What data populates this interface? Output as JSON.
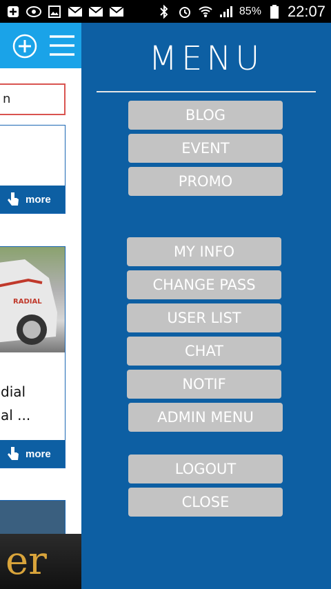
{
  "status_bar": {
    "battery_percent": "85%",
    "time": "22:07"
  },
  "background_app": {
    "search_text": "n",
    "card_more_label": "more",
    "card2_title": "dial",
    "card2_subtitle": "al ...",
    "bottom_text": "er"
  },
  "menu": {
    "title": "MENU",
    "items": [
      {
        "label": "BLOG"
      },
      {
        "label": "EVENT"
      },
      {
        "label": "PROMO"
      },
      {
        "label": "MY INFO"
      },
      {
        "label": "CHANGE PASS"
      },
      {
        "label": "USER LIST"
      },
      {
        "label": "CHAT"
      },
      {
        "label": "NOTIF"
      },
      {
        "label": "ADMIN MENU"
      },
      {
        "label": "LOGOUT"
      },
      {
        "label": "CLOSE"
      }
    ]
  },
  "colors": {
    "drawer_bg": "#0d5fa3",
    "button_bg": "#c3c3c3",
    "header_bg": "#1aa3e8"
  }
}
